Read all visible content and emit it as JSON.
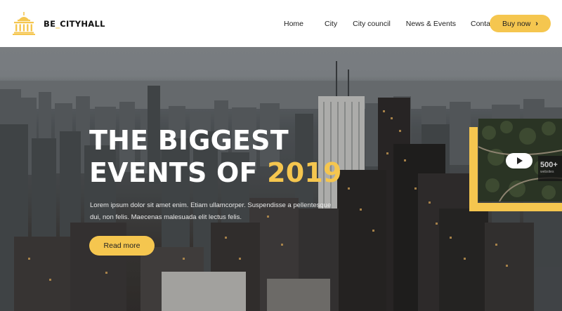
{
  "brand": {
    "name_left": "BE",
    "name_sep": "_",
    "name_right": "CITYHALL",
    "accent": "#f5c64f"
  },
  "nav": {
    "items": [
      {
        "label": "Home"
      },
      {
        "label": "City"
      },
      {
        "label": "City council"
      },
      {
        "label": "News & Events"
      },
      {
        "label": "Contact"
      }
    ],
    "buy_label": "Buy now",
    "buy_icon": "chevron-right-icon"
  },
  "hero": {
    "title_line1": "THE BIGGEST",
    "title_line2_prefix": "EVENTS OF ",
    "title_year": "2019",
    "description_line1": "Lorem ipsum dolor sit amet enim. Etiam ullamcorper. Suspendisse a pellentesque",
    "description_line2": "dui, non felis. Maecenas malesuada elit lectus felis.",
    "read_more_label": "Read more"
  },
  "video": {
    "play_icon": "play-icon",
    "stat_value": "500+",
    "stat_label": "websites"
  }
}
